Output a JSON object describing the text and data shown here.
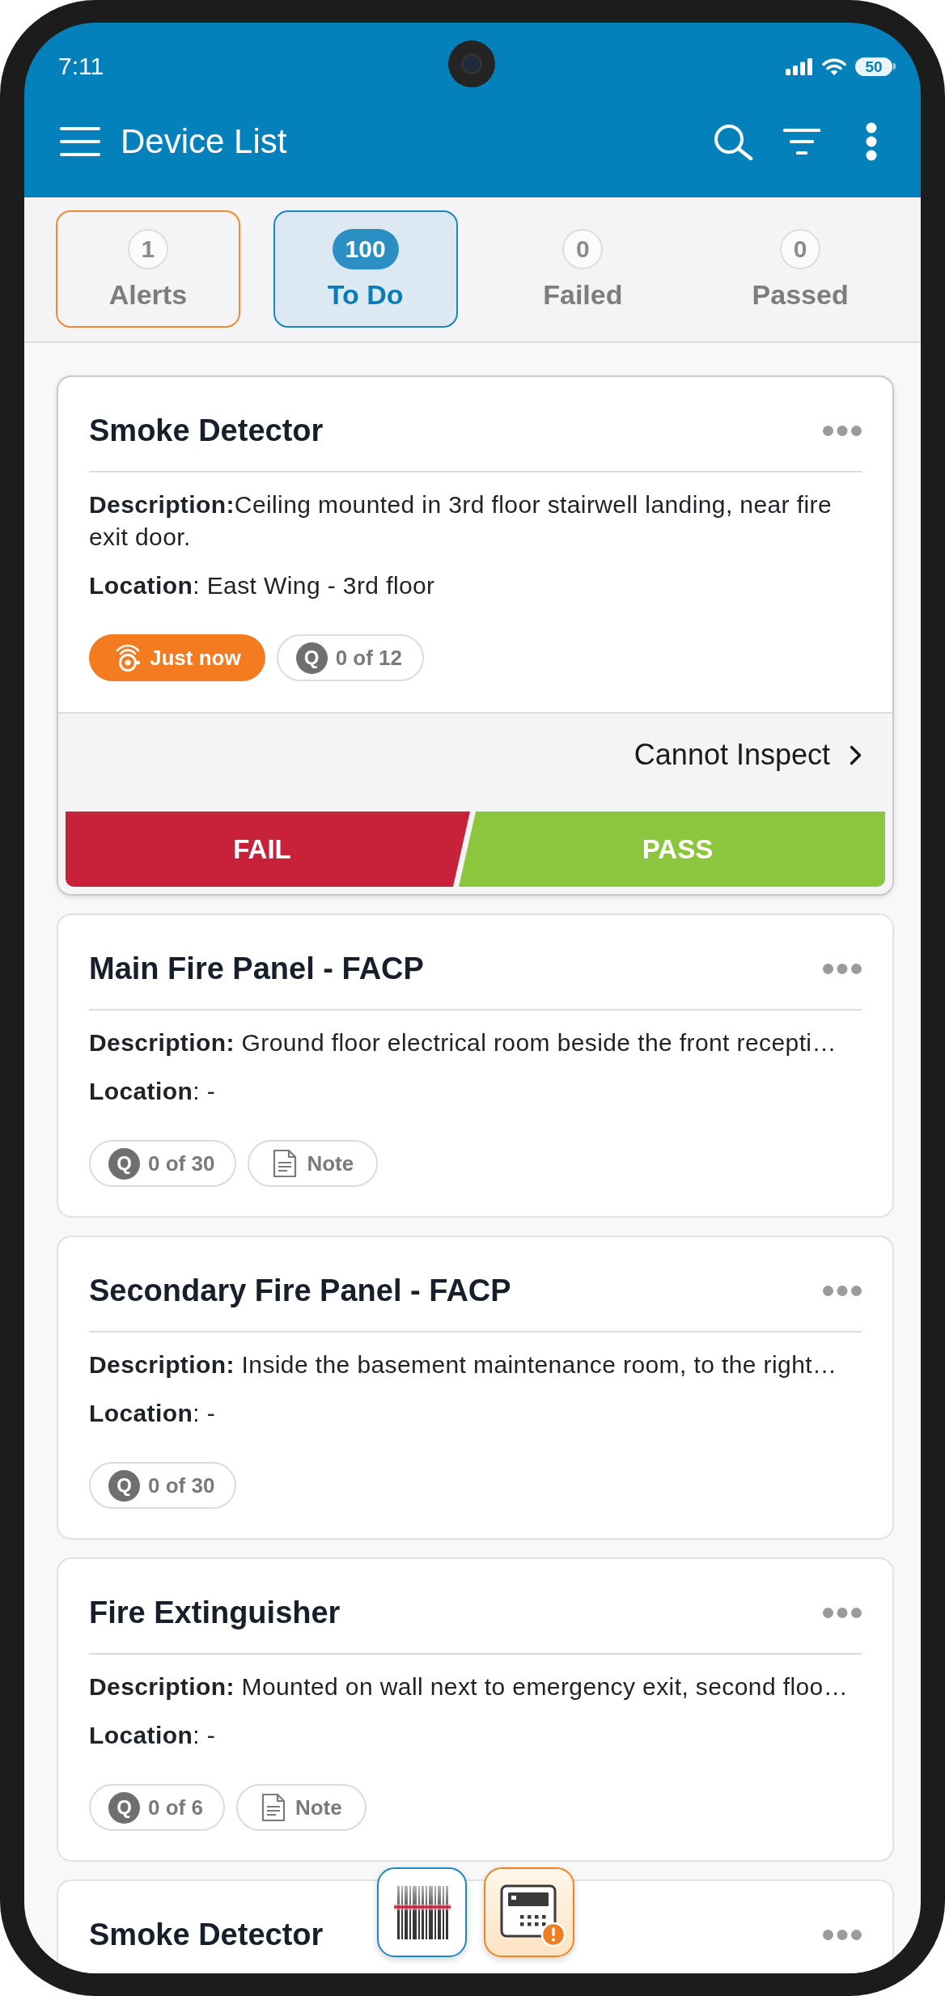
{
  "status_bar": {
    "time": "7:11",
    "battery": "50"
  },
  "app_bar": {
    "title": "Device List"
  },
  "tabs": [
    {
      "label": "Alerts",
      "count": "1",
      "selected": false,
      "alert": true
    },
    {
      "label": "To Do",
      "count": "100",
      "selected": true,
      "alert": false
    },
    {
      "label": "Failed",
      "count": "0",
      "selected": false,
      "alert": false
    },
    {
      "label": "Passed",
      "count": "0",
      "selected": false,
      "alert": false
    }
  ],
  "devices": [
    {
      "title": "Smoke Detector",
      "description": "**Description:**Ceiling mounted in 3rd floor stairwell landing, near fire exit door.",
      "location": "**Location**: East Wing - 3rd floor",
      "chips": [
        {
          "kind": "alarm",
          "label": "Just now"
        },
        {
          "kind": "questions",
          "badge": "Q",
          "label": "0 of 12"
        }
      ],
      "expanded": true,
      "cannot_inspect": "Cannot Inspect",
      "fail": "FAIL",
      "pass": "PASS"
    },
    {
      "title": "Main Fire Panel - FACP",
      "description": "**Description:** Ground floor electrical room beside the front recepti…",
      "location": "**Location**: -",
      "chips": [
        {
          "kind": "questions",
          "badge": "Q",
          "label": "0 of 30"
        },
        {
          "kind": "note",
          "label": "Note"
        }
      ],
      "expanded": false
    },
    {
      "title": "Secondary Fire Panel - FACP",
      "description": "**Description:** Inside the basement maintenance room, to the right…",
      "location": "**Location**: -",
      "chips": [
        {
          "kind": "questions",
          "badge": "Q",
          "label": "0 of 30"
        }
      ],
      "expanded": false
    },
    {
      "title": "Fire Extinguisher",
      "description": "**Description:** Mounted on wall next to emergency exit, second floo…",
      "location": "**Location**: -",
      "chips": [
        {
          "kind": "questions",
          "badge": "Q",
          "label": "0 of 6"
        },
        {
          "kind": "note",
          "label": "Note"
        }
      ],
      "expanded": false
    },
    {
      "title": "Smoke Detector",
      "expanded": false
    }
  ]
}
